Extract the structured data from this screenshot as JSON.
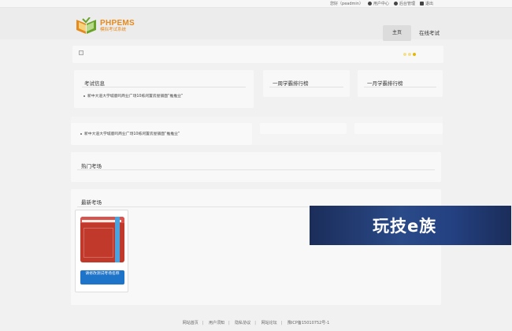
{
  "topbar": {
    "greeting": "您好（peadmin）",
    "user_center": "用户中心",
    "admin": "后台管理",
    "logout": "退出"
  },
  "logo": {
    "title": "PHPEMS",
    "subtitle": "模拟考试系统"
  },
  "nav": {
    "home": "主页",
    "online_exam": "在线考试"
  },
  "banner": {
    "dots": 3,
    "active_dot": 3
  },
  "panels": {
    "exam_info": {
      "title": "考试信息",
      "items": [
        "新中大道大学城鹿鸣商业广场10栋闲置房屋铺面“推推业”"
      ]
    },
    "week_rank": {
      "title": "一周学霸排行榜"
    },
    "month_rank": {
      "title": "一月学霸排行榜"
    },
    "second_news": {
      "items": [
        "新中大道大学城鹿鸣商业广场10栋闲置房屋铺面“推推业”"
      ]
    },
    "hot_exams": {
      "title": "热门考场"
    },
    "new_exams": {
      "title": "最新考场",
      "cards": [
        {
          "button": "请修改测试考场名称"
        }
      ]
    }
  },
  "watermark": {
    "text": "玩技e族"
  },
  "footer": {
    "links": [
      "网站首页",
      "用户须知",
      "隐私协议",
      "网站论坛",
      "豫ICP备15010752号-1"
    ]
  }
}
